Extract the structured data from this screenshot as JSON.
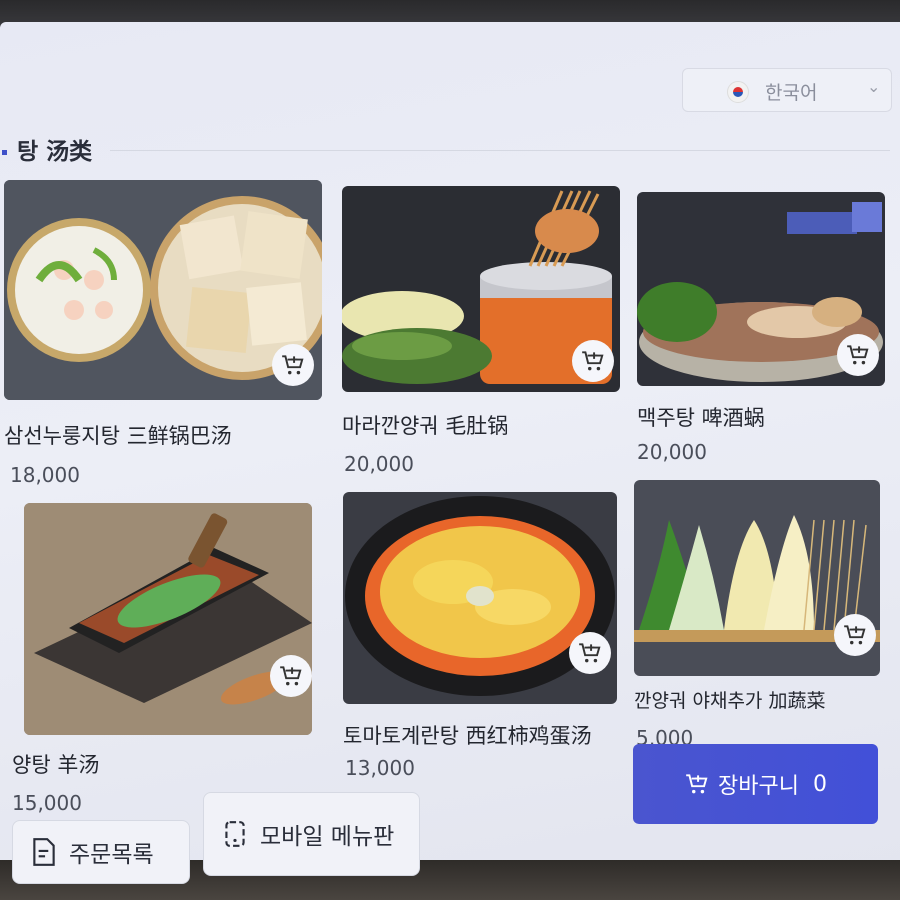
{
  "header": {
    "language": "한국어"
  },
  "section": {
    "title": "탕 汤类"
  },
  "items": [
    {
      "name": "삼선누룽지탕 三鲜锅巴汤",
      "price": "18,000",
      "icon": "cart-plus-icon"
    },
    {
      "name": "마라깐양궈 毛肚锅",
      "price": "20,000",
      "icon": "cart-plus-icon"
    },
    {
      "name": "맥주탕 啤酒蜗",
      "price": "20,000",
      "icon": "cart-plus-icon"
    },
    {
      "name": "양탕 羊汤",
      "price": "15,000",
      "icon": "cart-plus-icon"
    },
    {
      "name": "토마토계란탕 西红柿鸡蛋汤",
      "price": "13,000",
      "icon": "cart-plus-icon"
    },
    {
      "name": "깐양궈 야채추가 加蔬菜",
      "price": "5,000",
      "icon": "cart-plus-icon"
    }
  ],
  "footer": {
    "order_list_label": "주문목록",
    "mobile_menu_label": "모바일 메뉴판",
    "cart_label": "장바구니",
    "cart_count": "0"
  },
  "colors": {
    "accent": "#4a55cf",
    "screen_bg": "#e9ebf4",
    "text": "#23262f"
  }
}
